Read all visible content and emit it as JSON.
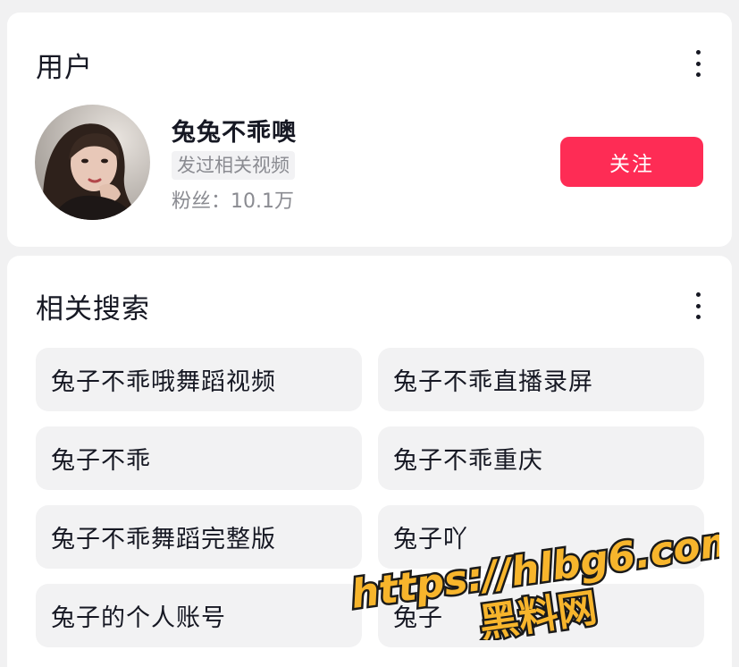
{
  "user_section": {
    "title": "用户",
    "more_icon": "more-vertical-icon",
    "user": {
      "nickname": "兔兔不乖噢",
      "tag": "发过相关视频",
      "fans": "粉丝：10.1万"
    },
    "follow_label": "关注"
  },
  "related_section": {
    "title": "相关搜索",
    "more_icon": "more-vertical-icon",
    "items": [
      "兔子不乖哦舞蹈视频",
      "兔子不乖直播录屏",
      "兔子不乖",
      "兔子不乖重庆",
      "兔子不乖舞蹈完整版",
      "兔子吖",
      "兔子的个人账号",
      "兔子"
    ]
  },
  "watermark": {
    "url": "https://hlbg6.com",
    "name": "黑料网"
  },
  "colors": {
    "accent": "#fe2c55",
    "background": "#f1f1f2",
    "card": "#ffffff",
    "chip": "#f2f2f3",
    "secondary_text": "#8a8b91",
    "watermark_fill": "#f7b52c"
  }
}
